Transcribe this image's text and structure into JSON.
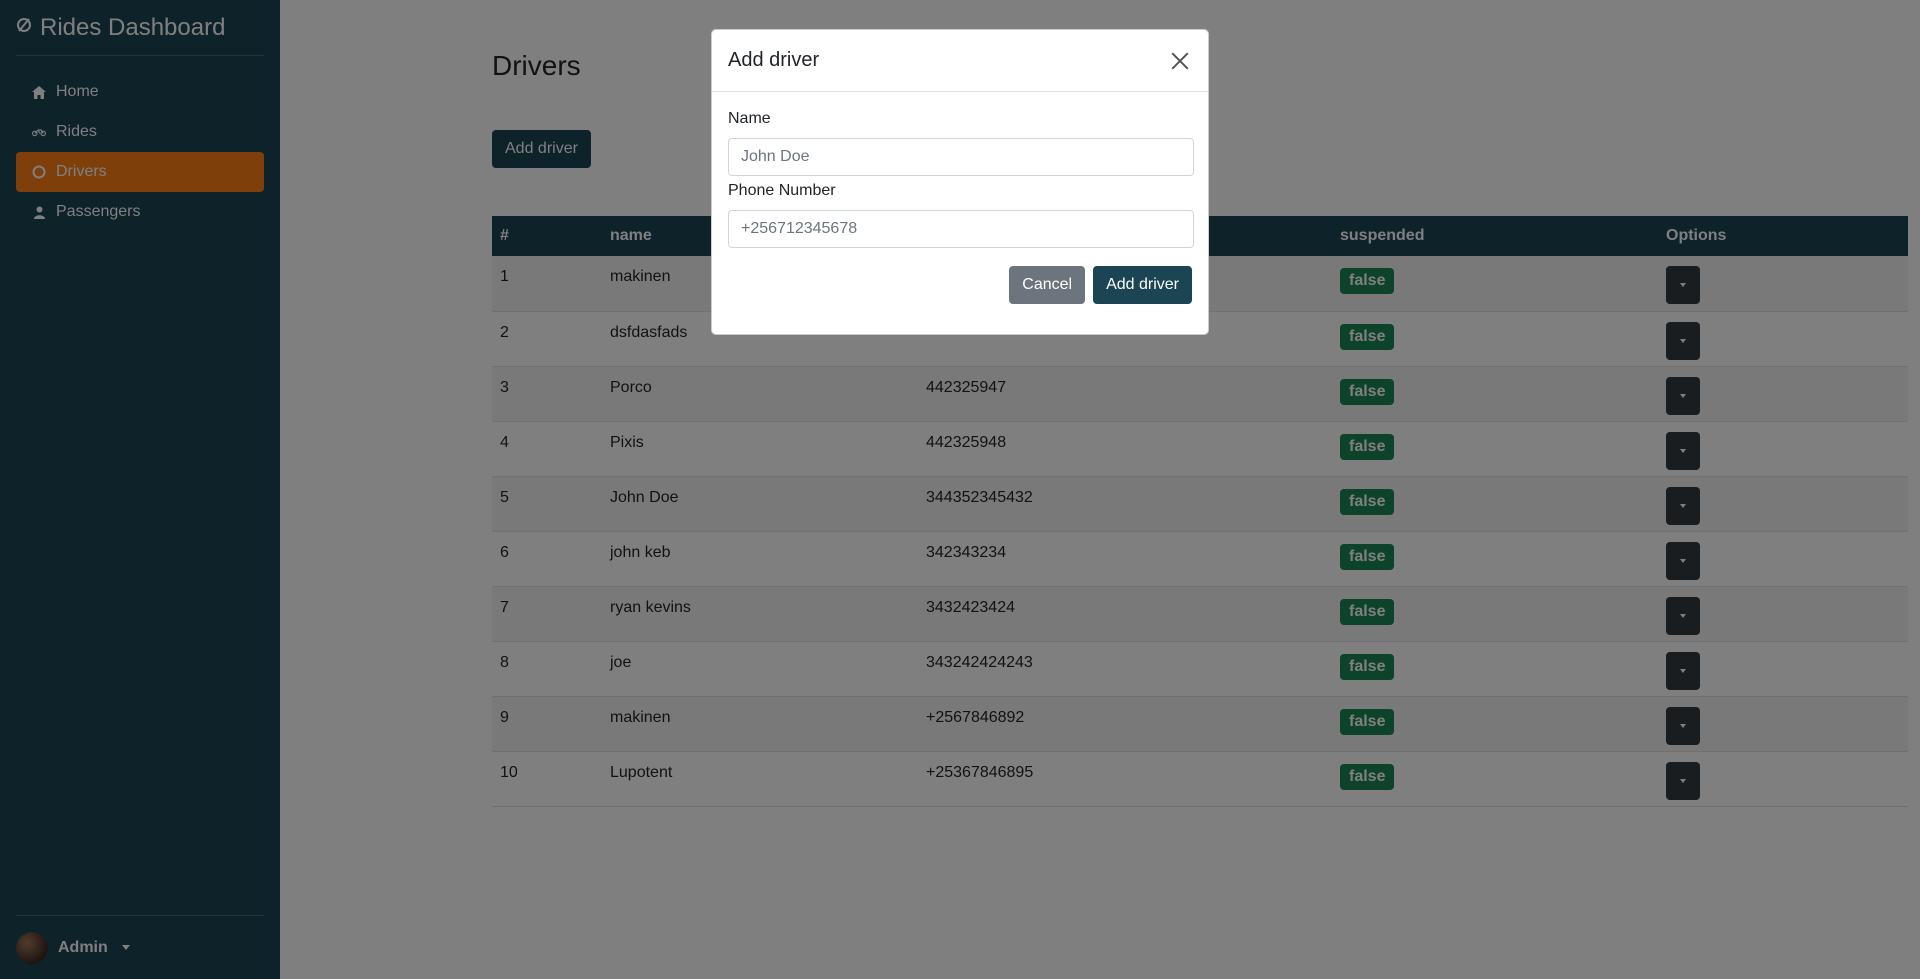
{
  "sidebar": {
    "brand": "Rides Dashboard",
    "items": [
      {
        "label": "Home",
        "icon": "home-icon"
      },
      {
        "label": "Rides",
        "icon": "motorcycle-icon"
      },
      {
        "label": "Drivers",
        "icon": "circle-icon",
        "active": true
      },
      {
        "label": "Passengers",
        "icon": "user-icon"
      }
    ],
    "user": "Admin"
  },
  "main": {
    "title": "Drivers",
    "add_button": "Add driver",
    "table": {
      "headers": [
        "#",
        "name",
        "",
        "suspended",
        "Options"
      ],
      "rows": [
        {
          "num": "1",
          "name": "makinen",
          "phone": "",
          "suspended": "false"
        },
        {
          "num": "2",
          "name": "dsfdasfads",
          "phone": "",
          "suspended": "false"
        },
        {
          "num": "3",
          "name": "Porco",
          "phone": "442325947",
          "suspended": "false"
        },
        {
          "num": "4",
          "name": "Pixis",
          "phone": "442325948",
          "suspended": "false"
        },
        {
          "num": "5",
          "name": "John Doe",
          "phone": "344352345432",
          "suspended": "false"
        },
        {
          "num": "6",
          "name": "john keb",
          "phone": "342343234",
          "suspended": "false"
        },
        {
          "num": "7",
          "name": "ryan kevins",
          "phone": "3432423424",
          "suspended": "false"
        },
        {
          "num": "8",
          "name": "joe",
          "phone": "343242424243",
          "suspended": "false"
        },
        {
          "num": "9",
          "name": "makinen",
          "phone": "+2567846892",
          "suspended": "false"
        },
        {
          "num": "10",
          "name": "Lupotent",
          "phone": "+25367846895",
          "suspended": "false"
        }
      ]
    }
  },
  "modal": {
    "title": "Add driver",
    "name_label": "Name",
    "name_placeholder": "John Doe",
    "phone_label": "Phone Number",
    "phone_placeholder": "+256712345678",
    "cancel": "Cancel",
    "submit": "Add driver"
  },
  "colors": {
    "sidebar_bg": "#1b4553",
    "active_nav": "#fd7e14",
    "badge": "#198754"
  }
}
